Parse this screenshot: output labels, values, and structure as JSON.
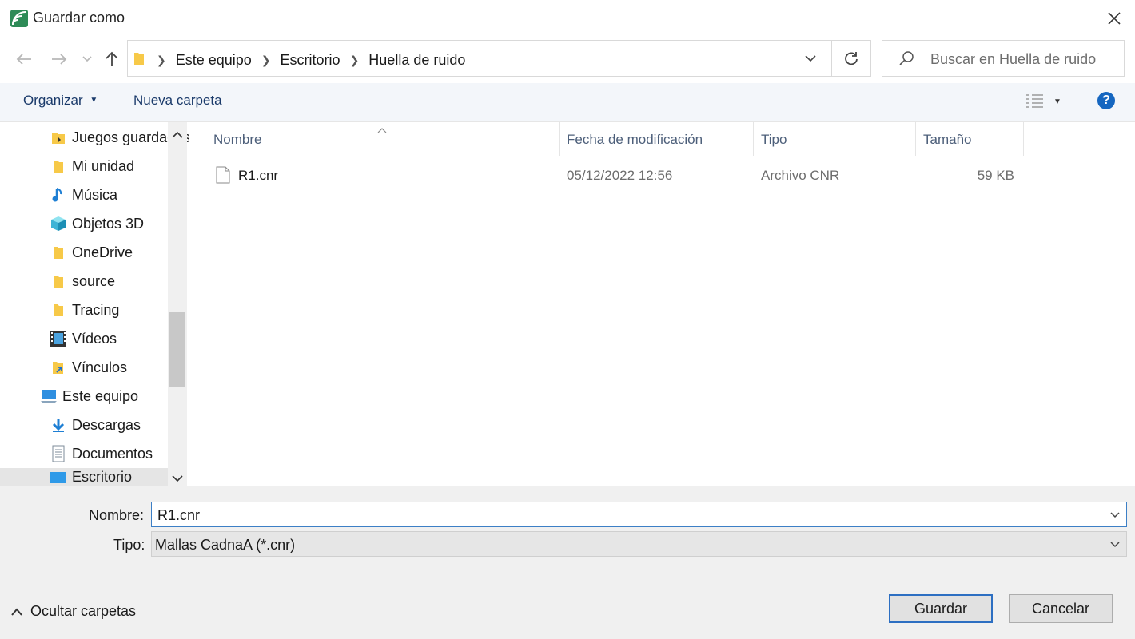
{
  "window": {
    "title": "Guardar como"
  },
  "address": {
    "crumbs": [
      "Este equipo",
      "Escritorio",
      "Huella de ruido"
    ]
  },
  "search": {
    "placeholder": "Buscar en Huella de ruido"
  },
  "toolbar": {
    "organize_label": "Organizar",
    "new_folder_label": "Nueva carpeta",
    "help_label": "?"
  },
  "nav": {
    "items": [
      {
        "label": "Juegos guardados",
        "icon": "folder-game-icon"
      },
      {
        "label": "Mi unidad",
        "icon": "folder-icon"
      },
      {
        "label": "Música",
        "icon": "music-icon"
      },
      {
        "label": "Objetos 3D",
        "icon": "cube-3d-icon"
      },
      {
        "label": "OneDrive",
        "icon": "folder-icon"
      },
      {
        "label": "source",
        "icon": "folder-icon"
      },
      {
        "label": "Tracing",
        "icon": "folder-icon"
      },
      {
        "label": "Vídeos",
        "icon": "video-icon"
      },
      {
        "label": "Vínculos",
        "icon": "folder-link-icon"
      },
      {
        "label": "Este equipo",
        "icon": "computer-icon"
      },
      {
        "label": "Descargas",
        "icon": "download-icon"
      },
      {
        "label": "Documentos",
        "icon": "documents-icon"
      },
      {
        "label": "Escritorio",
        "icon": "desktop-icon",
        "selected": true
      }
    ]
  },
  "files": {
    "columns": [
      "Nombre",
      "Fecha de modificación",
      "Tipo",
      "Tamaño"
    ],
    "rows": [
      {
        "name": "R1.cnr",
        "modified": "05/12/2022 12:56",
        "type": "Archivo CNR",
        "size": "59 KB"
      }
    ]
  },
  "form": {
    "name_label": "Nombre:",
    "name_value": "R1.cnr",
    "type_label": "Tipo:",
    "type_value": "Mallas CadnaA (*.cnr)"
  },
  "footer": {
    "hide_folders_label": "Ocultar carpetas",
    "save_label": "Guardar",
    "cancel_label": "Cancelar"
  },
  "colors": {
    "accent": "#2d6fc2",
    "folder": "#f7c948",
    "toolbar_bg": "#f3f6fa",
    "bottom_bg": "#f0f0f0"
  }
}
